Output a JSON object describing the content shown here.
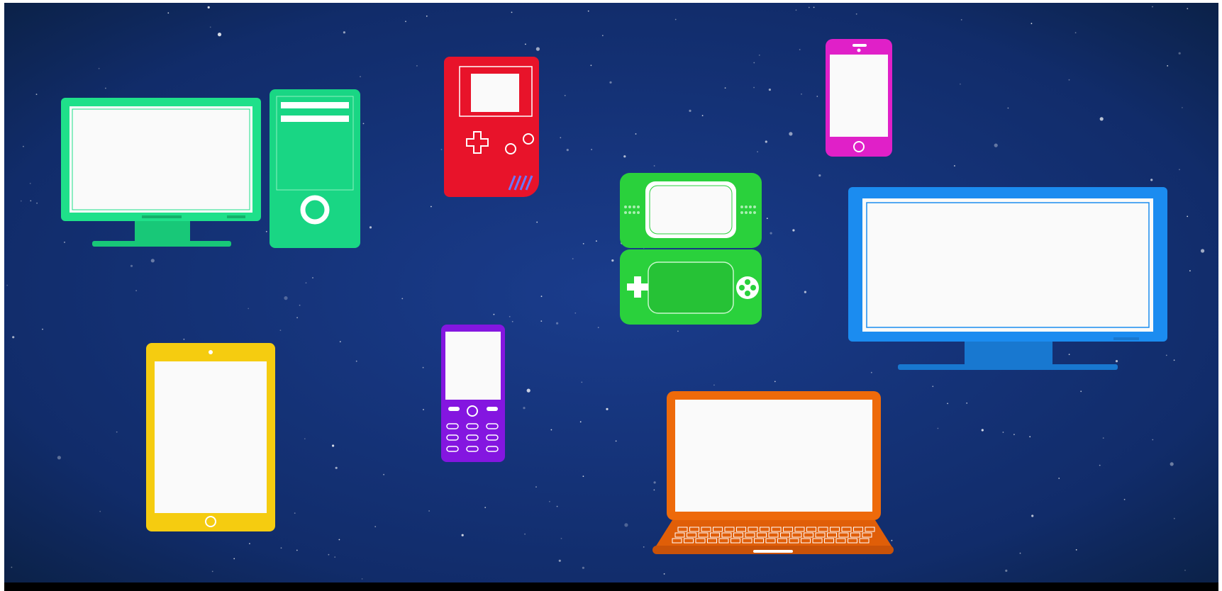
{
  "scene": {
    "description_tags": [
      "devices-illustration"
    ],
    "colors": {
      "space_center": "#1a3c8c",
      "space_edge": "#0a1f40",
      "letterbox": "#000000",
      "screen": "#fafafa",
      "desktop_monitor": "#1fe08a",
      "desktop_tower": "#19d684",
      "handheld_console": "#e8132a",
      "smartphone": "#e020c8",
      "dual_screen_console": "#2ad13c",
      "tv": "#1b8cf0",
      "tablet": "#f5cc10",
      "feature_phone": "#8416e0",
      "laptop": "#ee6a0a"
    },
    "icons": [
      "desktop-monitor-icon",
      "desktop-tower-icon",
      "handheld-console-icon",
      "smartphone-icon",
      "dual-screen-console-icon",
      "tv-icon",
      "tablet-icon",
      "feature-phone-icon",
      "laptop-icon"
    ]
  }
}
